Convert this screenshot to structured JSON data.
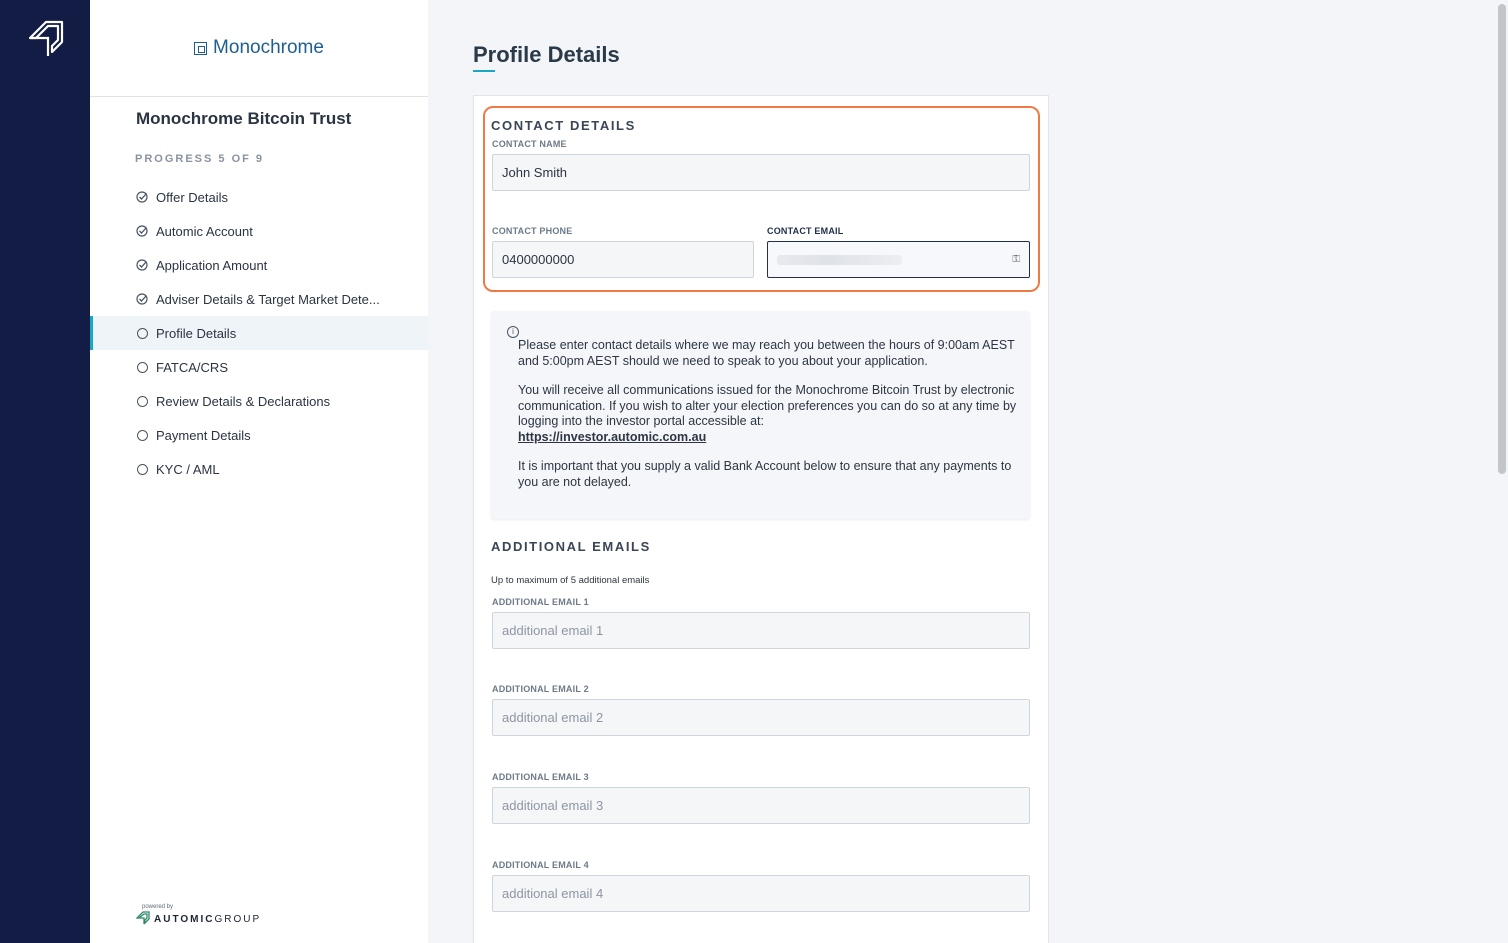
{
  "rail": {
    "logo_icon": "automic-logo-icon"
  },
  "sidebar": {
    "brand": "Monochrome",
    "trust_name": "Monochrome Bitcoin Trust",
    "progress": "PROGRESS 5 OF 9",
    "steps": [
      {
        "label": "Offer Details",
        "status": "complete"
      },
      {
        "label": "Automic Account",
        "status": "complete"
      },
      {
        "label": "Application Amount",
        "status": "complete"
      },
      {
        "label": "Adviser Details & Target Market Dete...",
        "status": "complete"
      },
      {
        "label": "Profile Details",
        "status": "current"
      },
      {
        "label": "FATCA/CRS",
        "status": "pending"
      },
      {
        "label": "Review Details & Declarations",
        "status": "pending"
      },
      {
        "label": "Payment Details",
        "status": "pending"
      },
      {
        "label": "KYC / AML",
        "status": "pending"
      }
    ],
    "powered_by_small": "powered by",
    "powered_by_brand": "AUTOMIC",
    "powered_by_suffix": "GROUP"
  },
  "main": {
    "title": "Profile Details",
    "contact": {
      "section_title": "CONTACT DETAILS",
      "name_label": "CONTACT NAME",
      "name_value": "John Smith",
      "phone_label": "CONTACT PHONE",
      "phone_value": "0400000000",
      "email_label": "CONTACT EMAIL"
    },
    "info": {
      "p1": "Please enter contact details where we may reach you between the hours of 9:00am AEST and 5:00pm AEST should we need to speak to you about your application.",
      "p2": "You will receive all communications issued for the Monochrome Bitcoin Trust by electronic communication. If you wish to alter your election preferences you can do so at any time by logging into the investor portal accessible at:",
      "link": "https://investor.automic.com.au",
      "p3": "It is important that you supply a valid Bank Account below to ensure that any payments to you are not delayed."
    },
    "additional": {
      "section_title": "ADDITIONAL EMAILS",
      "helper": "Up to maximum of 5 additional emails",
      "fields": [
        {
          "label": "ADDITIONAL EMAIL 1",
          "placeholder": "additional email 1"
        },
        {
          "label": "ADDITIONAL EMAIL 2",
          "placeholder": "additional email 2"
        },
        {
          "label": "ADDITIONAL EMAIL 3",
          "placeholder": "additional email 3"
        },
        {
          "label": "ADDITIONAL EMAIL 4",
          "placeholder": "additional email 4"
        }
      ]
    }
  },
  "colors": {
    "rail": "#121c44",
    "accent": "#1aa7c4",
    "highlight": "#f07a45",
    "brand": "#1f5f8f"
  }
}
